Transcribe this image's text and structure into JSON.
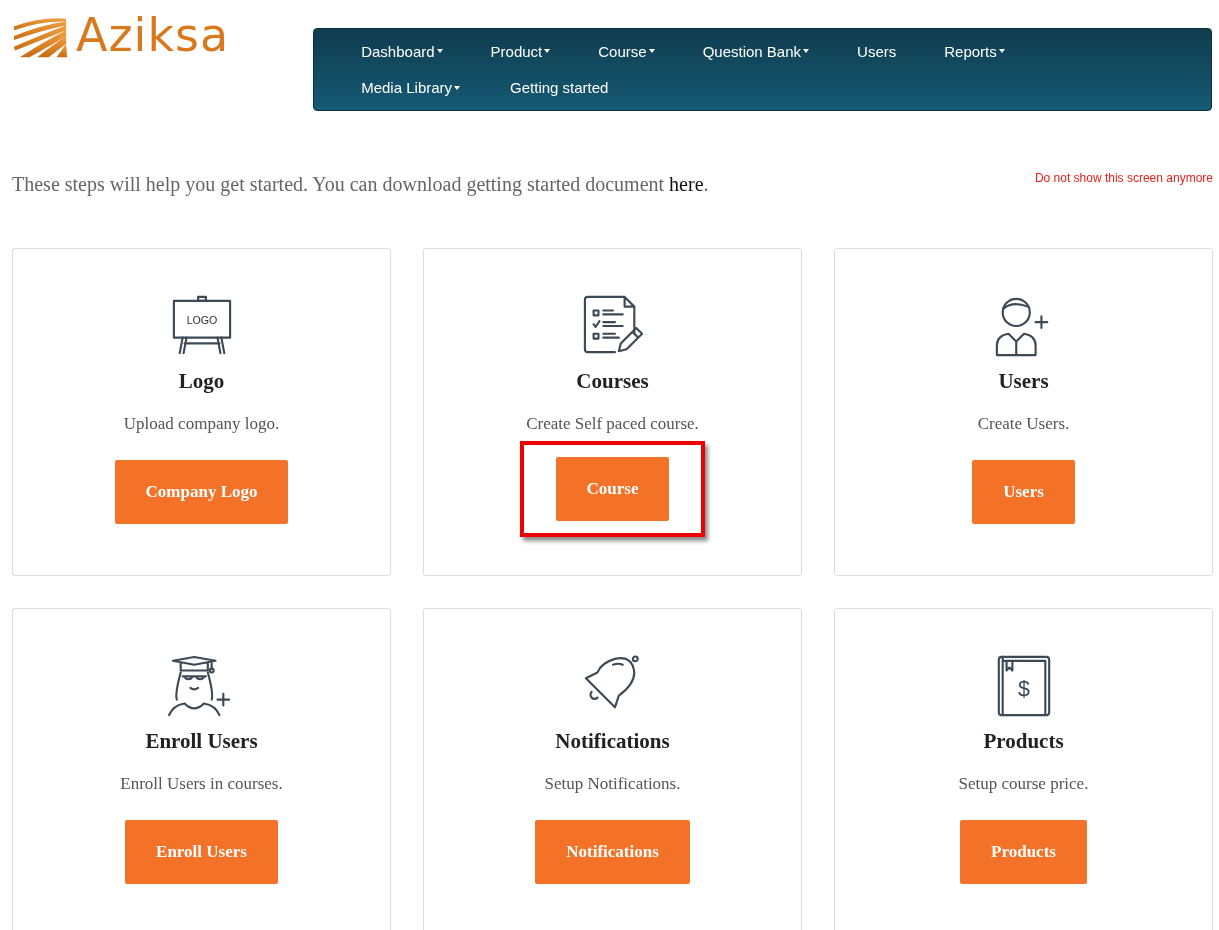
{
  "brand": {
    "name": "Aziksa"
  },
  "nav": [
    {
      "label": "Dashboard",
      "dropdown": true
    },
    {
      "label": "Product",
      "dropdown": true
    },
    {
      "label": "Course",
      "dropdown": true
    },
    {
      "label": "Question Bank",
      "dropdown": true
    },
    {
      "label": "Users",
      "dropdown": false
    },
    {
      "label": "Reports",
      "dropdown": true
    },
    {
      "label": "Media Library",
      "dropdown": true
    },
    {
      "label": "Getting started",
      "dropdown": false
    }
  ],
  "intro": {
    "text": "These steps will help you get started. You can download getting started document",
    "link": "here",
    "end": "."
  },
  "dismiss_link": "Do not show this screen anymore",
  "cards": [
    {
      "kind": "logo",
      "icon_label": "LOGO",
      "title": "Logo",
      "description": "Upload company logo.",
      "button": "Company Logo",
      "highlighted": false
    },
    {
      "kind": "courses",
      "title": "Courses",
      "description": "Create Self paced course.",
      "button": "Course",
      "highlighted": true
    },
    {
      "kind": "users",
      "title": "Users",
      "description": "Create Users.",
      "button": "Users",
      "highlighted": false
    },
    {
      "kind": "enroll",
      "title": "Enroll Users",
      "description": "Enroll Users in courses.",
      "button": "Enroll Users",
      "highlighted": false
    },
    {
      "kind": "notifications",
      "title": "Notifications",
      "description": "Setup Notifications.",
      "button": "Notifications",
      "highlighted": false
    },
    {
      "kind": "products",
      "icon_label": "$",
      "title": "Products",
      "description": "Setup course price.",
      "button": "Products",
      "highlighted": false
    }
  ]
}
